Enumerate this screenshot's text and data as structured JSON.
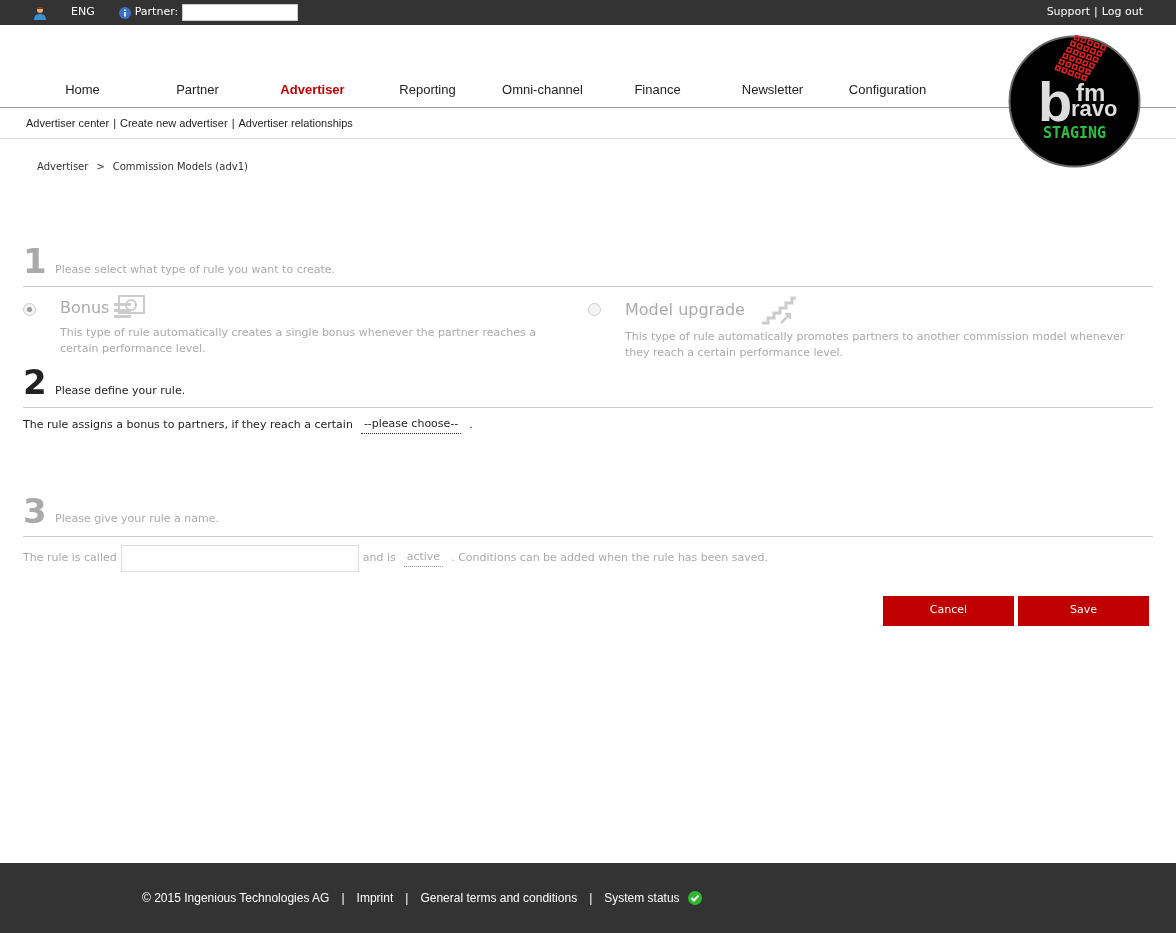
{
  "top_bar": {
    "language": "ENG",
    "partner_label": "Partner:",
    "links": [
      "Support",
      "Log out"
    ],
    "separator": "|"
  },
  "logo": {
    "letter": "b",
    "top": "fm",
    "bottom": "ravo",
    "badge": "STAGING"
  },
  "nav": [
    {
      "label": "Home",
      "selected": false
    },
    {
      "label": "Partner",
      "selected": false
    },
    {
      "label": "Advertiser",
      "selected": true
    },
    {
      "label": "Reporting",
      "selected": false
    },
    {
      "label": "Omni-channel",
      "selected": false
    },
    {
      "label": "Finance",
      "selected": false
    },
    {
      "label": "Newsletter",
      "selected": false
    },
    {
      "label": "Configuration",
      "selected": false
    }
  ],
  "subnav": {
    "items": [
      "Advertiser center",
      "Create new advertiser",
      "Advertiser relationships"
    ],
    "separator": "|"
  },
  "breadcrumb": [
    "Advertiser",
    ">",
    "Commission Models (adv1)"
  ],
  "steps": [
    {
      "number": "1",
      "title": "Please select what type of rule you want to create.",
      "active": false,
      "kind": "choice",
      "options": [
        {
          "kind": "bonus",
          "label": "Bonus",
          "selected": true,
          "description": "This type of rule automatically creates a single bonus whenever the partner reaches a certain performance level."
        },
        {
          "kind": "upgrade",
          "label": "Model upgrade",
          "selected": false,
          "description": "This type of rule automatically promotes partners to another commission model whenever they reach a certain performance level."
        }
      ]
    },
    {
      "number": "2",
      "title": "Please define your rule.",
      "active": true,
      "kind": "sentence",
      "parts": [
        {
          "kind": "text",
          "text": "The rule assigns a bonus to partners, if they reach a certain"
        },
        {
          "kind": "dropdown",
          "text": "--please choose--"
        },
        {
          "kind": "text",
          "text": "."
        }
      ]
    },
    {
      "number": "3",
      "title": "Please give your rule a name.",
      "active": false,
      "kind": "sentence",
      "parts": [
        {
          "kind": "text",
          "text": "The rule is called"
        },
        {
          "kind": "input"
        },
        {
          "kind": "text",
          "text": "and is"
        },
        {
          "kind": "dropdown",
          "text": "active"
        },
        {
          "kind": "text",
          "text": ". Conditions can be added when the rule has been saved."
        }
      ]
    }
  ],
  "buttons": [
    "Cancel",
    "Save"
  ],
  "footer": {
    "items": [
      "© 2015 Ingenious Technologies AG",
      "Imprint",
      "General terms and conditions",
      "System status"
    ],
    "separator": "|",
    "status_ok": true
  }
}
